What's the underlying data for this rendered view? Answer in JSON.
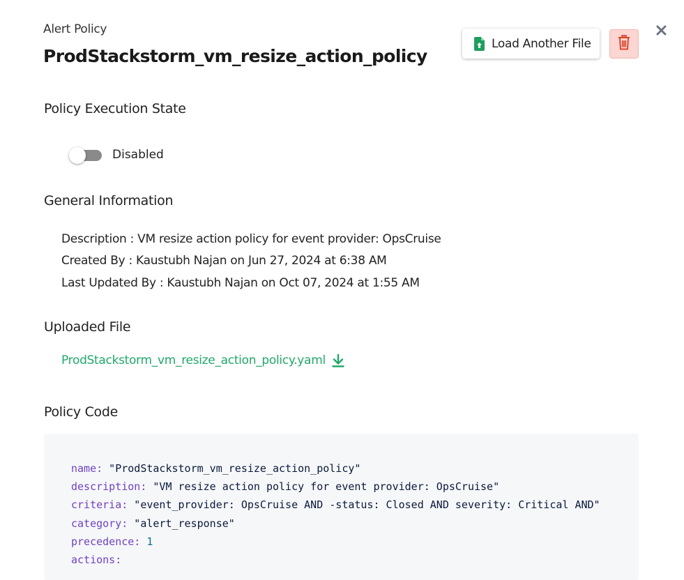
{
  "header": {
    "subtitle": "Alert Policy",
    "title": "ProdStackstorm_vm_resize_action_policy",
    "load_button_label": "Load Another File",
    "load_icon": "file-upload-icon",
    "delete_icon": "trash-icon",
    "close_icon": "close-icon"
  },
  "execution": {
    "heading": "Policy Execution State",
    "toggle_state": "Disabled",
    "enabled": false
  },
  "general": {
    "heading": "General Information",
    "description": "Description : VM resize action policy for event provider: OpsCruise",
    "created_by": "Created By : Kaustubh Najan on Jun 27, 2024 at 6:38 AM",
    "last_updated_by": "Last Updated By : Kaustubh Najan on Oct 07, 2024 at 1:55 AM"
  },
  "uploaded": {
    "heading": "Uploaded File",
    "file_name": "ProdStackstorm_vm_resize_action_policy.yaml",
    "download_icon": "download-icon"
  },
  "code": {
    "heading": "Policy Code",
    "lines": [
      {
        "key": "name:",
        "value": " \"ProdStackstorm_vm_resize_action_policy\""
      },
      {
        "key": "description:",
        "value": " \"VM resize action policy for event provider: OpsCruise\""
      },
      {
        "key": "criteria:",
        "value": " \"event_provider: OpsCruise AND -status: Closed AND severity: Critical AND\""
      },
      {
        "key": "category:",
        "value": " \"alert_response\""
      },
      {
        "key": "precedence:",
        "value": " 1",
        "numeric": true
      },
      {
        "key": "actions:",
        "value": ""
      }
    ]
  },
  "colors": {
    "link": "#20a86a",
    "delete_bg": "#fbd6d2",
    "delete_icon": "#e0462f",
    "upload_icon": "#1e9e5e",
    "code_key": "#6f42c1",
    "code_bg": "#f6f7f9"
  }
}
